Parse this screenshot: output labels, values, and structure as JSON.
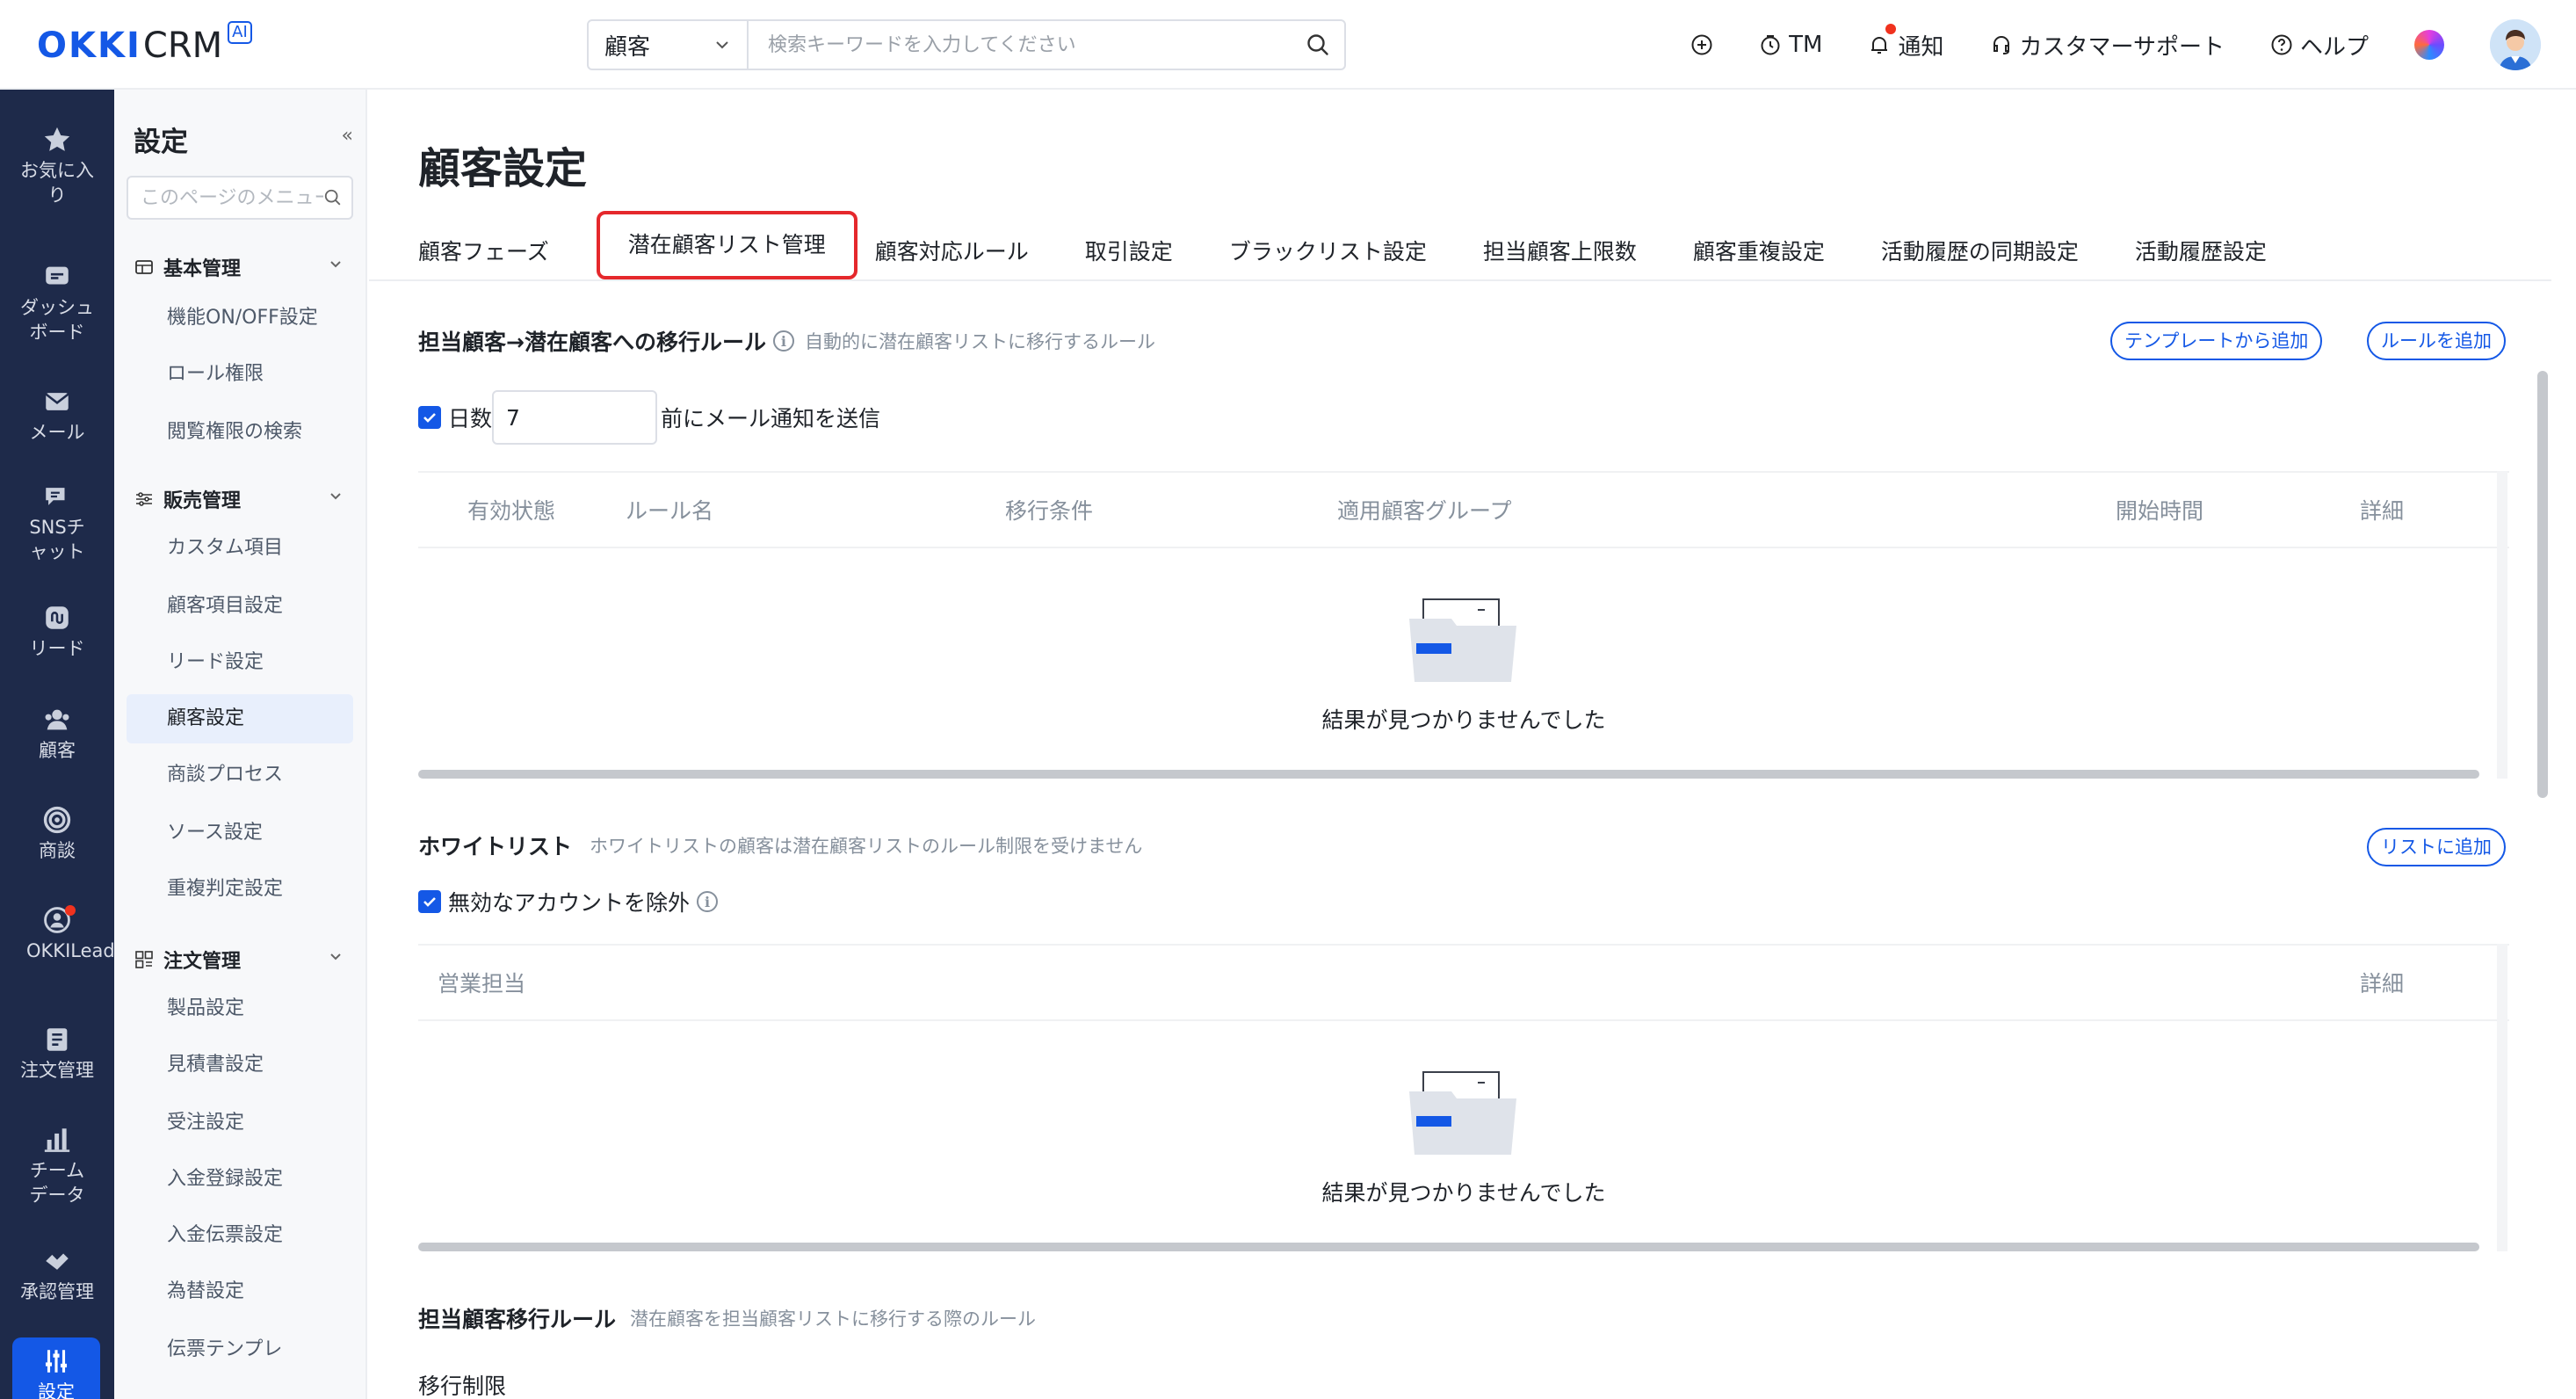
{
  "app": {
    "logo_text": "OKKI",
    "logo_crm": "CRM",
    "logo_badge": "AI",
    "search_scope": "顧客",
    "search_placeholder": "検索キーワードを入力してください",
    "actions": {
      "tm": "TM",
      "notify": "通知",
      "support": "カスタマーサポート",
      "help": "ヘルプ"
    }
  },
  "rail": [
    {
      "label": "お気に入り",
      "icon": "star-icon"
    },
    {
      "label": "ダッシュボード",
      "icon": "dashboard-icon"
    },
    {
      "label": "メール",
      "icon": "mail-icon"
    },
    {
      "label": "SNSチャット",
      "icon": "chat-icon"
    },
    {
      "label": "リード",
      "icon": "lead-icon"
    },
    {
      "label": "顧客",
      "icon": "customer-icon"
    },
    {
      "label": "商談",
      "icon": "target-icon"
    },
    {
      "label": "OKKILeads",
      "icon": "okki-leads-icon"
    },
    {
      "label": "注文管理",
      "icon": "order-icon"
    },
    {
      "label": "チームデータ",
      "icon": "bar-chart-icon"
    },
    {
      "label": "承認管理",
      "icon": "approval-icon"
    },
    {
      "label": "設定",
      "icon": "settings-sliders-icon"
    }
  ],
  "submenu": {
    "title": "設定",
    "collapse": "«",
    "search_placeholder": "このページのメニュー",
    "groups": [
      {
        "label": "基本管理",
        "items": [
          "機能ON/OFF設定",
          "ロール権限",
          "閲覧権限の検索"
        ]
      },
      {
        "label": "販売管理",
        "items": [
          "カスタム項目",
          "顧客項目設定",
          "リード設定",
          "顧客設定",
          "商談プロセス",
          "ソース設定",
          "重複判定設定"
        ]
      },
      {
        "label": "注文管理",
        "items": [
          "製品設定",
          "見積書設定",
          "受注設定",
          "入金登録設定",
          "入金伝票設定",
          "為替設定",
          "伝票テンプレ"
        ]
      }
    ],
    "active_item": "顧客設定"
  },
  "page": {
    "title": "顧客設定",
    "tabs": [
      "顧客フェーズ",
      "潜在顧客リスト管理",
      "顧客対応ルール",
      "取引設定",
      "ブラックリスト設定",
      "担当顧客上限数",
      "顧客重複設定",
      "活動履歴の同期設定",
      "活動履歴設定"
    ],
    "active_tab": "潜在顧客リスト管理"
  },
  "section1": {
    "title": "担当顧客→潜在顧客への移行ルール",
    "desc": "自動的に潜在顧客リストに移行するルール",
    "btn_template": "テンプレートから追加",
    "btn_add_rule": "ルールを追加",
    "days_label": "日数",
    "days_value": "7",
    "days_suffix": "前にメール通知を送信",
    "columns": [
      "有効状態",
      "ルール名",
      "移行条件",
      "適用顧客グループ",
      "開始時間",
      "詳細"
    ],
    "empty_text": "結果が見つかりませんでした"
  },
  "section2": {
    "title": "ホワイトリスト",
    "desc": "ホワイトリストの顧客は潜在顧客リストのルール制限を受けません",
    "btn_add": "リストに追加",
    "checkbox_label": "無効なアカウントを除外",
    "columns": [
      "営業担当",
      "詳細"
    ],
    "empty_text": "結果が見つかりませんでした"
  },
  "section3": {
    "title": "担当顧客移行ルール",
    "desc": "潜在顧客を担当顧客リストに移行する際のルール",
    "sub_label": "移行制限"
  },
  "colors": {
    "brand": "#1458e6",
    "rail_bg": "#1e2a4a",
    "highlight_red": "#e5282c"
  }
}
